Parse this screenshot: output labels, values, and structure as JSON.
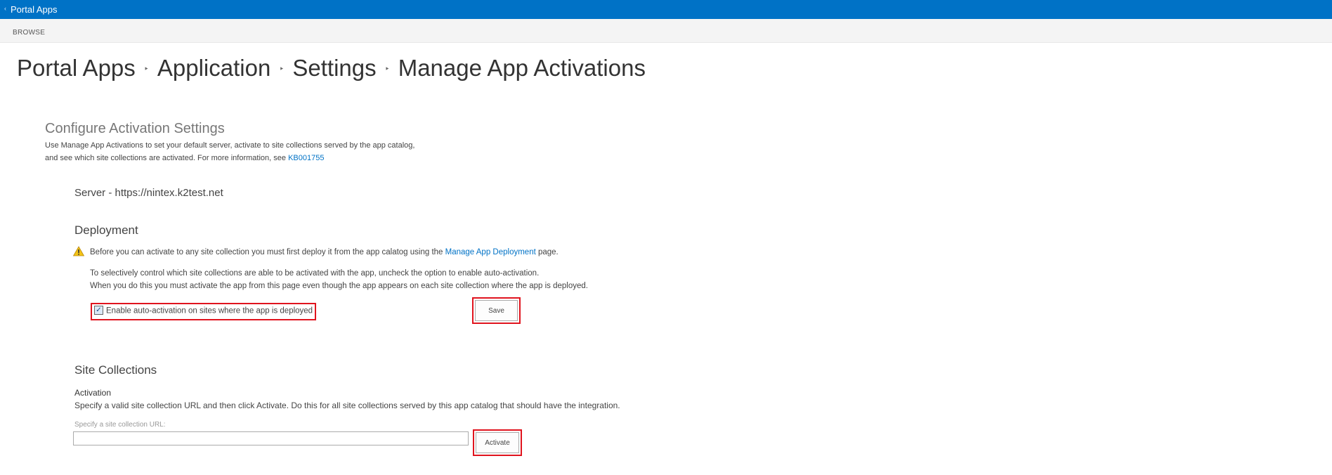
{
  "topbar": {
    "title": "Portal Apps",
    "back_icon": "‹"
  },
  "ribbon": {
    "browse": "BROWSE"
  },
  "breadcrumb": {
    "items": [
      "Portal Apps",
      "Application",
      "Settings",
      "Manage App Activations"
    ],
    "separator": "‣"
  },
  "config": {
    "heading": "Configure Activation Settings",
    "desc_line1": "Use Manage App Activations to set your default  server, activate to site collections served by the app catalog,",
    "desc_line2_prefix": "and see which site collections are activated. For more information, see ",
    "desc_link": "KB001755"
  },
  "server": {
    "label": "Server - https://nintex.k2test.net"
  },
  "deployment": {
    "heading": "Deployment",
    "warning_prefix": "Before you can activate to any site collection you must first deploy it from the app calatog using the ",
    "warning_link": "Manage App Deployment",
    "warning_suffix": " page.",
    "info_line1": "To selectively control which site collections are able to be activated with the app, uncheck the option to enable auto-activation.",
    "info_line2": "When you do this you must activate the app from this page even though the app appears on each site collection where the app is deployed.",
    "checkbox_label": "Enable auto-activation on sites where the app is deployed",
    "checkbox_checked": true,
    "save_label": "Save"
  },
  "site_collections": {
    "heading": "Site Collections",
    "activation_label": "Activation",
    "activation_desc": "Specify a valid site collection URL and then click Activate. Do this for all site collections served by this app catalog that should have the integration.",
    "url_label": "Specify a site collection URL:",
    "url_value": "",
    "activate_label": "Activate"
  },
  "colors": {
    "topbar": "#0072c6",
    "link": "#0072c6",
    "highlight": "#e0141e"
  }
}
